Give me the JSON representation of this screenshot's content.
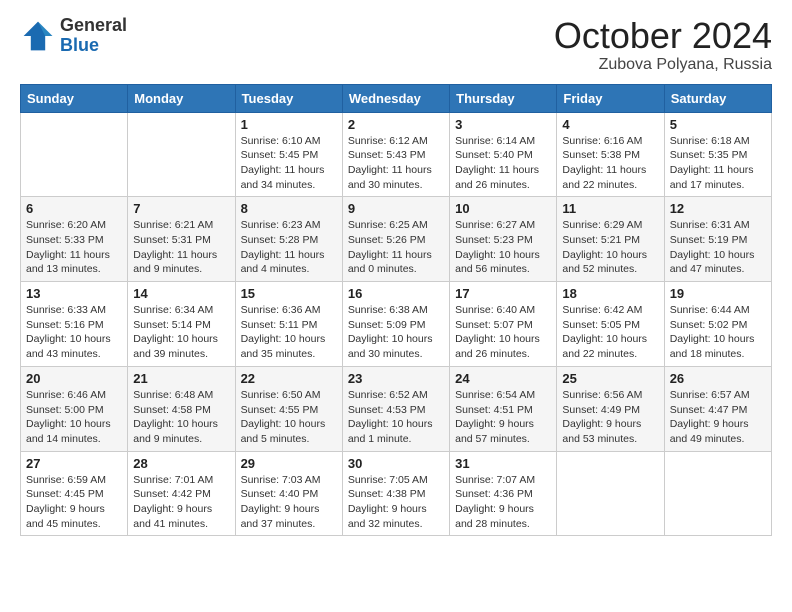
{
  "header": {
    "logo_general": "General",
    "logo_blue": "Blue",
    "month_title": "October 2024",
    "location": "Zubova Polyana, Russia"
  },
  "weekdays": [
    "Sunday",
    "Monday",
    "Tuesday",
    "Wednesday",
    "Thursday",
    "Friday",
    "Saturday"
  ],
  "weeks": [
    [
      {
        "day": "",
        "sunrise": "",
        "sunset": "",
        "daylight": ""
      },
      {
        "day": "",
        "sunrise": "",
        "sunset": "",
        "daylight": ""
      },
      {
        "day": "1",
        "sunrise": "Sunrise: 6:10 AM",
        "sunset": "Sunset: 5:45 PM",
        "daylight": "Daylight: 11 hours and 34 minutes."
      },
      {
        "day": "2",
        "sunrise": "Sunrise: 6:12 AM",
        "sunset": "Sunset: 5:43 PM",
        "daylight": "Daylight: 11 hours and 30 minutes."
      },
      {
        "day": "3",
        "sunrise": "Sunrise: 6:14 AM",
        "sunset": "Sunset: 5:40 PM",
        "daylight": "Daylight: 11 hours and 26 minutes."
      },
      {
        "day": "4",
        "sunrise": "Sunrise: 6:16 AM",
        "sunset": "Sunset: 5:38 PM",
        "daylight": "Daylight: 11 hours and 22 minutes."
      },
      {
        "day": "5",
        "sunrise": "Sunrise: 6:18 AM",
        "sunset": "Sunset: 5:35 PM",
        "daylight": "Daylight: 11 hours and 17 minutes."
      }
    ],
    [
      {
        "day": "6",
        "sunrise": "Sunrise: 6:20 AM",
        "sunset": "Sunset: 5:33 PM",
        "daylight": "Daylight: 11 hours and 13 minutes."
      },
      {
        "day": "7",
        "sunrise": "Sunrise: 6:21 AM",
        "sunset": "Sunset: 5:31 PM",
        "daylight": "Daylight: 11 hours and 9 minutes."
      },
      {
        "day": "8",
        "sunrise": "Sunrise: 6:23 AM",
        "sunset": "Sunset: 5:28 PM",
        "daylight": "Daylight: 11 hours and 4 minutes."
      },
      {
        "day": "9",
        "sunrise": "Sunrise: 6:25 AM",
        "sunset": "Sunset: 5:26 PM",
        "daylight": "Daylight: 11 hours and 0 minutes."
      },
      {
        "day": "10",
        "sunrise": "Sunrise: 6:27 AM",
        "sunset": "Sunset: 5:23 PM",
        "daylight": "Daylight: 10 hours and 56 minutes."
      },
      {
        "day": "11",
        "sunrise": "Sunrise: 6:29 AM",
        "sunset": "Sunset: 5:21 PM",
        "daylight": "Daylight: 10 hours and 52 minutes."
      },
      {
        "day": "12",
        "sunrise": "Sunrise: 6:31 AM",
        "sunset": "Sunset: 5:19 PM",
        "daylight": "Daylight: 10 hours and 47 minutes."
      }
    ],
    [
      {
        "day": "13",
        "sunrise": "Sunrise: 6:33 AM",
        "sunset": "Sunset: 5:16 PM",
        "daylight": "Daylight: 10 hours and 43 minutes."
      },
      {
        "day": "14",
        "sunrise": "Sunrise: 6:34 AM",
        "sunset": "Sunset: 5:14 PM",
        "daylight": "Daylight: 10 hours and 39 minutes."
      },
      {
        "day": "15",
        "sunrise": "Sunrise: 6:36 AM",
        "sunset": "Sunset: 5:11 PM",
        "daylight": "Daylight: 10 hours and 35 minutes."
      },
      {
        "day": "16",
        "sunrise": "Sunrise: 6:38 AM",
        "sunset": "Sunset: 5:09 PM",
        "daylight": "Daylight: 10 hours and 30 minutes."
      },
      {
        "day": "17",
        "sunrise": "Sunrise: 6:40 AM",
        "sunset": "Sunset: 5:07 PM",
        "daylight": "Daylight: 10 hours and 26 minutes."
      },
      {
        "day": "18",
        "sunrise": "Sunrise: 6:42 AM",
        "sunset": "Sunset: 5:05 PM",
        "daylight": "Daylight: 10 hours and 22 minutes."
      },
      {
        "day": "19",
        "sunrise": "Sunrise: 6:44 AM",
        "sunset": "Sunset: 5:02 PM",
        "daylight": "Daylight: 10 hours and 18 minutes."
      }
    ],
    [
      {
        "day": "20",
        "sunrise": "Sunrise: 6:46 AM",
        "sunset": "Sunset: 5:00 PM",
        "daylight": "Daylight: 10 hours and 14 minutes."
      },
      {
        "day": "21",
        "sunrise": "Sunrise: 6:48 AM",
        "sunset": "Sunset: 4:58 PM",
        "daylight": "Daylight: 10 hours and 9 minutes."
      },
      {
        "day": "22",
        "sunrise": "Sunrise: 6:50 AM",
        "sunset": "Sunset: 4:55 PM",
        "daylight": "Daylight: 10 hours and 5 minutes."
      },
      {
        "day": "23",
        "sunrise": "Sunrise: 6:52 AM",
        "sunset": "Sunset: 4:53 PM",
        "daylight": "Daylight: 10 hours and 1 minute."
      },
      {
        "day": "24",
        "sunrise": "Sunrise: 6:54 AM",
        "sunset": "Sunset: 4:51 PM",
        "daylight": "Daylight: 9 hours and 57 minutes."
      },
      {
        "day": "25",
        "sunrise": "Sunrise: 6:56 AM",
        "sunset": "Sunset: 4:49 PM",
        "daylight": "Daylight: 9 hours and 53 minutes."
      },
      {
        "day": "26",
        "sunrise": "Sunrise: 6:57 AM",
        "sunset": "Sunset: 4:47 PM",
        "daylight": "Daylight: 9 hours and 49 minutes."
      }
    ],
    [
      {
        "day": "27",
        "sunrise": "Sunrise: 6:59 AM",
        "sunset": "Sunset: 4:45 PM",
        "daylight": "Daylight: 9 hours and 45 minutes."
      },
      {
        "day": "28",
        "sunrise": "Sunrise: 7:01 AM",
        "sunset": "Sunset: 4:42 PM",
        "daylight": "Daylight: 9 hours and 41 minutes."
      },
      {
        "day": "29",
        "sunrise": "Sunrise: 7:03 AM",
        "sunset": "Sunset: 4:40 PM",
        "daylight": "Daylight: 9 hours and 37 minutes."
      },
      {
        "day": "30",
        "sunrise": "Sunrise: 7:05 AM",
        "sunset": "Sunset: 4:38 PM",
        "daylight": "Daylight: 9 hours and 32 minutes."
      },
      {
        "day": "31",
        "sunrise": "Sunrise: 7:07 AM",
        "sunset": "Sunset: 4:36 PM",
        "daylight": "Daylight: 9 hours and 28 minutes."
      },
      {
        "day": "",
        "sunrise": "",
        "sunset": "",
        "daylight": ""
      },
      {
        "day": "",
        "sunrise": "",
        "sunset": "",
        "daylight": ""
      }
    ]
  ]
}
